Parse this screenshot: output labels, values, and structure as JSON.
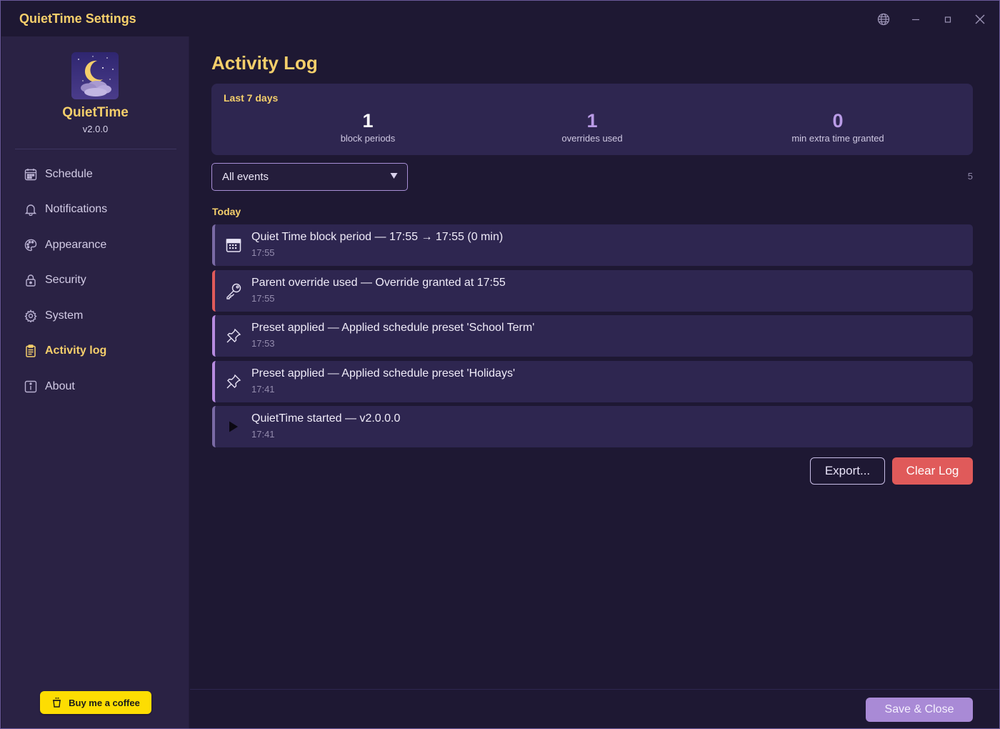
{
  "window": {
    "title": "QuietTime Settings"
  },
  "brand": {
    "name": "QuietTime",
    "version": "v2.0.0"
  },
  "sidebar": {
    "items": [
      {
        "label": "Schedule",
        "icon": "calendar-icon"
      },
      {
        "label": "Notifications",
        "icon": "bell-icon"
      },
      {
        "label": "Appearance",
        "icon": "palette-icon"
      },
      {
        "label": "Security",
        "icon": "lock-icon"
      },
      {
        "label": "System",
        "icon": "gear-icon"
      },
      {
        "label": "Activity log",
        "icon": "clipboard-icon",
        "active": true
      },
      {
        "label": "About",
        "icon": "info-icon"
      }
    ],
    "coffee_label": "Buy me a coffee"
  },
  "page": {
    "title": "Activity Log"
  },
  "summary": {
    "label": "Last 7 days",
    "stats": [
      {
        "value": "1",
        "caption": "block periods",
        "color": "#ffffff"
      },
      {
        "value": "1",
        "caption": "overrides used",
        "color": "#b99be6"
      },
      {
        "value": "0",
        "caption": "min extra time granted",
        "color": "#b99be6"
      }
    ]
  },
  "filter": {
    "selected": "All events",
    "count": "5"
  },
  "groups": [
    {
      "header": "Today",
      "entries": [
        {
          "text": "Quiet Time block period — 17:55 → 17:55 (0 min)",
          "time": "17:55",
          "icon": "calendar-icon",
          "kind": "block"
        },
        {
          "text": "Parent override used — Override granted at 17:55",
          "time": "17:55",
          "icon": "key-icon",
          "kind": "override"
        },
        {
          "text": "Preset applied — Applied schedule preset 'School Term'",
          "time": "17:53",
          "icon": "pin-icon",
          "kind": "preset"
        },
        {
          "text": "Preset applied — Applied schedule preset 'Holidays'",
          "time": "17:41",
          "icon": "pin-icon",
          "kind": "preset"
        },
        {
          "text": "QuietTime started — v2.0.0.0",
          "time": "17:41",
          "icon": "play-icon",
          "kind": "start"
        }
      ]
    }
  ],
  "actions": {
    "export_label": "Export...",
    "clear_label": "Clear Log"
  },
  "footer": {
    "save_label": "Save & Close"
  },
  "colors": {
    "accent": "#f5cf6b",
    "danger": "#e05a5a",
    "purple": "#a98ad6",
    "panel": "#2e2650",
    "background": "#1e1833"
  }
}
